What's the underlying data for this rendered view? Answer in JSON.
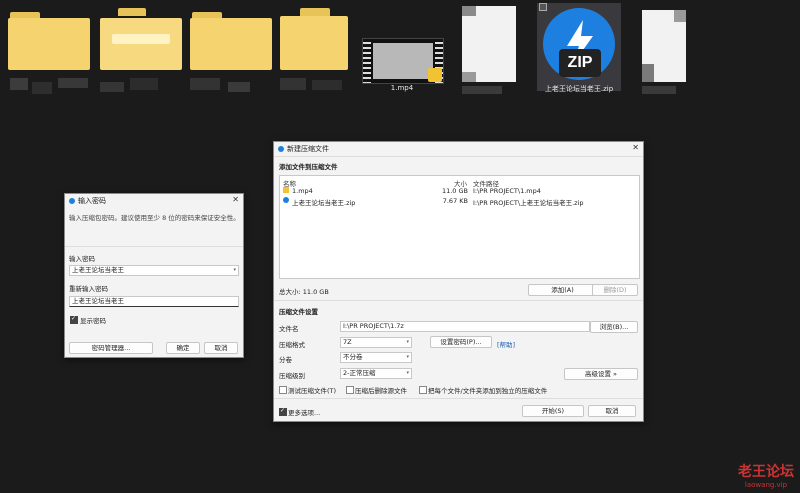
{
  "desktop": {
    "video_label": "1.mp4",
    "zip_label": "上老王论坛当老王.zip",
    "zip_badge": "ZIP"
  },
  "password_dialog": {
    "title": "输入密码",
    "hint": "输入压缩包密码。建议使用至少 8 位的密码来保证安全性。",
    "enter_label": "输入密码",
    "enter_value": "上老王论坛当老王",
    "reenter_label": "重新输入密码",
    "reenter_value": "上老王论坛当老王",
    "show_password_label": "显示密码",
    "show_password_checked": true,
    "manager_button": "密码管理器...",
    "ok_button": "确定",
    "cancel_button": "取消"
  },
  "compress_dialog": {
    "title": "新建压缩文件",
    "add_section": "添加文件到压缩文件",
    "columns": {
      "name": "名称",
      "size": "大小",
      "path": "文件路径"
    },
    "files": [
      {
        "name": "1.mp4",
        "size": "11.0 GB",
        "path": "I:\\PR PROJECT\\1.mp4",
        "icon": "video-file-icon"
      },
      {
        "name": "上老王论坛当老王.zip",
        "size": "7.67 KB",
        "path": "I:\\PR PROJECT\\上老王论坛当老王.zip",
        "icon": "zip-file-icon"
      }
    ],
    "total": "总大小: 11.0 GB",
    "add_button": "添加(A)",
    "delete_button": "删除(D)",
    "settings_section": "压缩文件设置",
    "filename_label": "文件名",
    "filename_value": "I:\\PR PROJECT\\1.7z",
    "browse_button": "浏览(B)...",
    "format_label": "压缩格式",
    "format_value": "7Z",
    "set_password_button": "设置密码(P)...",
    "help_link": "[帮助]",
    "split_label": "分卷",
    "split_value": "不分卷",
    "level_label": "压缩级别",
    "level_value": "2-正常压缩",
    "advanced_button": "高级设置 »",
    "opt_test": "测试压缩文件(T)",
    "opt_delete": "压缩后删除源文件",
    "opt_each": "把每个文件/文件夹添加到独立的压缩文件",
    "more_options": "更多选项...",
    "more_options_checked": true,
    "start_button": "开始(S)",
    "cancel_button": "取消"
  },
  "watermark": {
    "main": "老王论坛",
    "sub": "laowang.vip"
  },
  "colors": {
    "folder": "#f5d36e",
    "zip_blue": "#1d7fe0",
    "watermark": "#cc3333"
  }
}
